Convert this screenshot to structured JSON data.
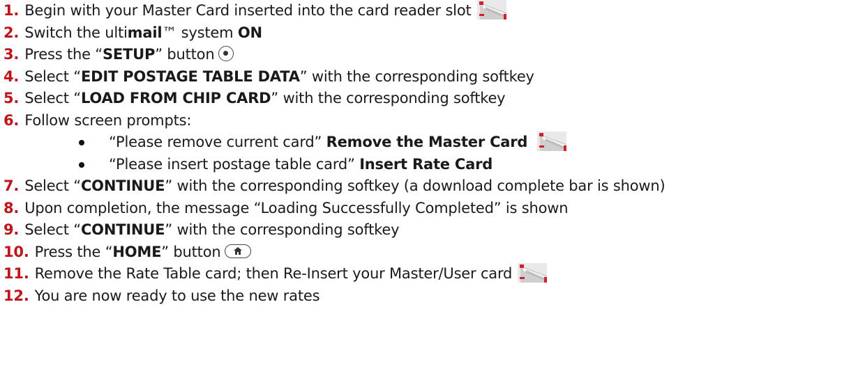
{
  "steps": [
    {
      "num": "1.",
      "parts": [
        {
          "t": "Begin with your Master Card inserted into the card reader slot",
          "b": false
        }
      ],
      "icon": "card-icon"
    },
    {
      "num": "2.",
      "parts": [
        {
          "t": "Switch the ulti",
          "b": false
        },
        {
          "t": "mail",
          "b": true
        },
        {
          "t": "™ system ",
          "b": false
        },
        {
          "t": "ON",
          "b": true
        }
      ]
    },
    {
      "num": "3.",
      "parts": [
        {
          "t": "Press the “",
          "b": false
        },
        {
          "t": "SETUP",
          "b": true
        },
        {
          "t": "” button",
          "b": false
        }
      ],
      "icon": "setup-button-icon"
    },
    {
      "num": "4.",
      "parts": [
        {
          "t": "Select “",
          "b": false
        },
        {
          "t": "EDIT POSTAGE TABLE DATA",
          "b": true
        },
        {
          "t": "” with the corresponding softkey",
          "b": false
        }
      ]
    },
    {
      "num": "5.",
      "parts": [
        {
          "t": "Select “",
          "b": false
        },
        {
          "t": "LOAD FROM CHIP CARD",
          "b": true
        },
        {
          "t": "” with the corresponding softkey",
          "b": false
        }
      ]
    },
    {
      "num": "6.",
      "parts": [
        {
          "t": "Follow screen prompts:",
          "b": false
        }
      ]
    },
    {
      "num": "7.",
      "parts": [
        {
          "t": "Select “",
          "b": false
        },
        {
          "t": "CONTINUE",
          "b": true
        },
        {
          "t": "” with the corresponding softkey (a download complete bar is shown)",
          "b": false
        }
      ]
    },
    {
      "num": "8.",
      "parts": [
        {
          "t": "Upon completion, the message “Loading Successfully Completed” is shown",
          "b": false
        }
      ]
    },
    {
      "num": "9.",
      "parts": [
        {
          "t": "Select “",
          "b": false
        },
        {
          "t": "CONTINUE",
          "b": true
        },
        {
          "t": "” with the corresponding softkey",
          "b": false
        }
      ]
    },
    {
      "num": "10.",
      "parts": [
        {
          "t": "Press the “",
          "b": false
        },
        {
          "t": "HOME",
          "b": true
        },
        {
          "t": "” button",
          "b": false
        }
      ],
      "icon": "home-button-icon"
    },
    {
      "num": "11.",
      "parts": [
        {
          "t": "Remove the Rate Table card; then Re-Insert your Master/User card",
          "b": false
        }
      ],
      "icon": "card-icon"
    },
    {
      "num": "12.",
      "parts": [
        {
          "t": "You are now ready to use the new rates",
          "b": false
        }
      ]
    }
  ],
  "sub_bullets": [
    {
      "parts": [
        {
          "t": "“Please remove current card” ",
          "b": false
        },
        {
          "t": "Remove the Master Card",
          "b": true
        }
      ],
      "icon": "card-icon"
    },
    {
      "parts": [
        {
          "t": "“Please insert postage table card” ",
          "b": false
        },
        {
          "t": "Insert Rate Card",
          "b": true
        }
      ]
    }
  ],
  "colors": {
    "number": "#c0141c",
    "text": "#1a1a1a",
    "card_red": "#d0202a"
  }
}
